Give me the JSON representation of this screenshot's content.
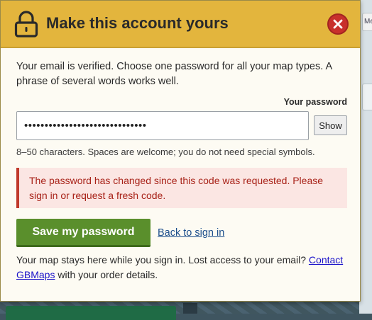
{
  "modal": {
    "title": "Make this account yours",
    "close_icon": "close-icon",
    "lock_icon": "lock-icon",
    "intro": "Your email is verified. Choose one password for all your map types. A phrase of several words works well.",
    "password_label": "Your password",
    "password_value": "••••••••••••••••••••••••••••••",
    "show_label": "Show",
    "hint": "8–50 characters. Spaces are welcome; you do not need special symbols.",
    "error": "The password has changed since this code was requested. Please sign in or request a fresh code.",
    "save_label": "Save my password",
    "back_label": "Back to sign in",
    "footer_text_before": "Your map stays here while you sign in. Lost access to your email? ",
    "footer_link": "Contact GBMaps",
    "footer_text_after": " with your order details."
  },
  "background": {
    "side_tab_text": "Mea"
  },
  "colors": {
    "header": "#e3b53d",
    "close": "#c8302c",
    "save": "#5a8f2c",
    "error_text": "#a82218",
    "error_bg": "#fbe6e3",
    "link": "#1a12c9"
  }
}
